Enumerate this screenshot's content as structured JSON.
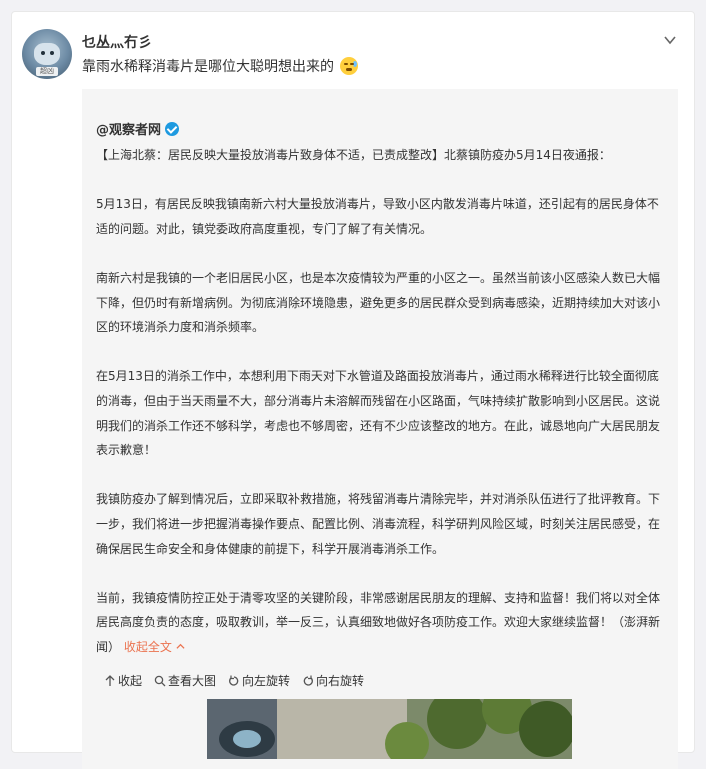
{
  "post": {
    "username": "乜丛灬冇彡",
    "text": "靠雨水稀释消毒片是哪位大聪明想出来的",
    "avatar_tag": "超凶"
  },
  "repost": {
    "author": "@观察者网",
    "paragraphs": [
      "【上海北蔡：居民反映大量投放消毒片致身体不适，已责成整改】北蔡镇防疫办5月14日夜通报：",
      "5月13日，有居民反映我镇南新六村大量投放消毒片，导致小区内散发消毒片味道，还引起有的居民身体不适的问题。对此，镇党委政府高度重视，专门了解了有关情况。",
      "南新六村是我镇的一个老旧居民小区，也是本次疫情较为严重的小区之一。虽然当前该小区感染人数已大幅下降，但仍时有新增病例。为彻底消除环境隐患，避免更多的居民群众受到病毒感染，近期持续加大对该小区的环境消杀力度和消杀频率。",
      "在5月13日的消杀工作中，本想利用下雨天对下水管道及路面投放消毒片，通过雨水稀释进行比较全面彻底的消毒，但由于当天雨量不大，部分消毒片未溶解而残留在小区路面，气味持续扩散影响到小区居民。这说明我们的消杀工作还不够科学，考虑也不够周密，还有不少应该整改的地方。在此，诚恳地向广大居民朋友表示歉意！",
      "我镇防疫办了解到情况后，立即采取补救措施，将残留消毒片清除完毕，并对消杀队伍进行了批评教育。下一步，我们将进一步把握消毒操作要点、配置比例、消毒流程，科学研判风险区域，时刻关注居民感受，在确保居民生命安全和身体健康的前提下，科学开展消毒消杀工作。",
      "当前，我镇疫情防控正处于清零攻坚的关键阶段，非常感谢居民朋友的理解、支持和监督！我们将以对全体居民高度负责的态度，吸取教训，举一反三，认真细致地做好各项防疫工作。欢迎大家继续监督！（澎湃新闻）"
    ],
    "collapse_link": "收起全文"
  },
  "toolbar": {
    "collapse": "收起",
    "view_large": "查看大图",
    "rotate_left": "向左旋转",
    "rotate_right": "向右旋转"
  },
  "colors": {
    "accent": "#eb7350",
    "verify": "#1e9ae0"
  }
}
